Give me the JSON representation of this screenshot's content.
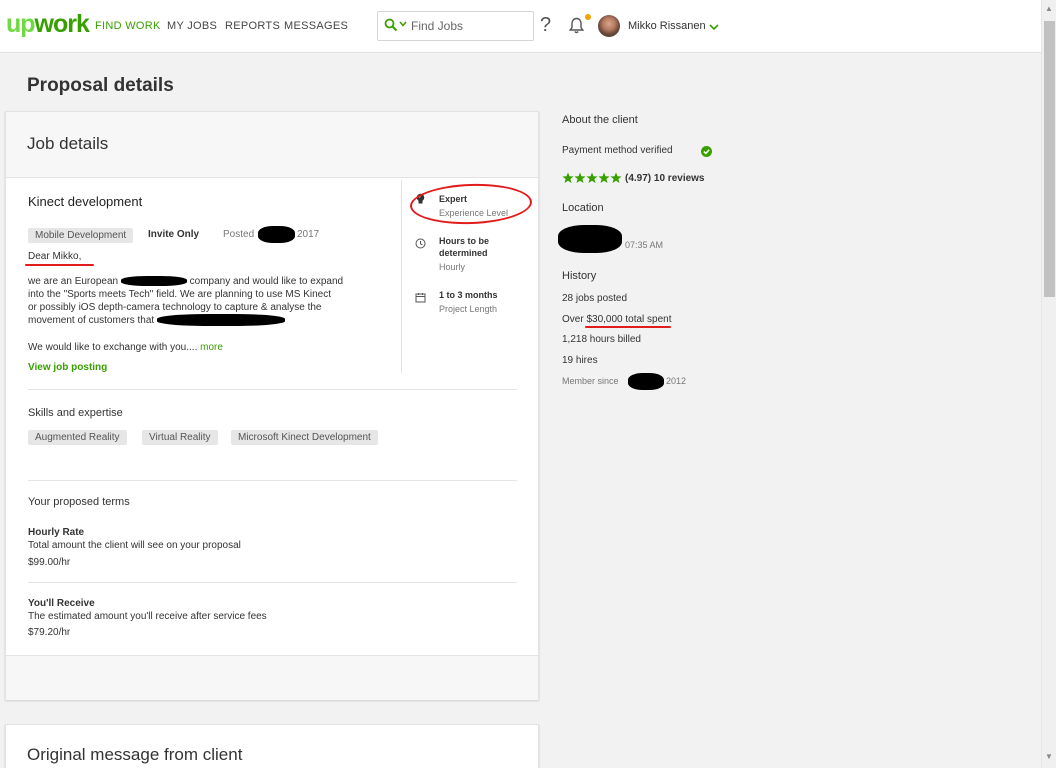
{
  "nav": {
    "logo": "upwork",
    "items": [
      {
        "label": "FIND WORK",
        "active": true
      },
      {
        "label": "MY JOBS",
        "active": false
      },
      {
        "label": "REPORTS",
        "active": false
      },
      {
        "label": "MESSAGES",
        "active": false
      }
    ],
    "search_placeholder": "Find Jobs",
    "help": "?",
    "user_name": "Mikko Rissanen",
    "accent": "#37a000",
    "notification_dot": "#f2a200"
  },
  "page": {
    "title": "Proposal details"
  },
  "job": {
    "header": "Job details",
    "title": "Kinect development",
    "category": "Mobile Development",
    "visibility": "Invite Only",
    "posted_label": "Posted",
    "posted_year": "2017",
    "greeting": "Dear Mikko,",
    "desc_a": "we are an European",
    "desc_b": "company and would like to expand",
    "desc_c": "into the \"Sports meets Tech\" field. We are planning to use MS Kinect",
    "desc_d": "or possibly iOS depth-camera technology to capture & analyse the",
    "desc_e": "movement of customers that",
    "desc_more_text": "We would like to exchange with you....",
    "more": "more",
    "view_posting": "View job posting",
    "features": [
      {
        "icon": "lightbulb-icon",
        "title": "Expert",
        "sub": "Experience Level"
      },
      {
        "icon": "clock-icon",
        "title": "Hours to be determined",
        "sub": "Hourly"
      },
      {
        "icon": "calendar-icon",
        "title": "1 to 3 months",
        "sub": "Project Length"
      }
    ],
    "skills_title": "Skills and expertise",
    "skills": [
      "Augmented Reality",
      "Virtual Reality",
      "Microsoft Kinect Development"
    ],
    "terms_title": "Your proposed terms",
    "hourly_label": "Hourly Rate",
    "hourly_desc": "Total amount the client will see on your proposal",
    "hourly_value": "$99.00/hr",
    "receive_label": "You'll Receive",
    "receive_desc": "The estimated amount you'll receive after service fees",
    "receive_value": "$79.20/hr"
  },
  "original_message": {
    "title": "Original message from client"
  },
  "client": {
    "title": "About the client",
    "payment": "Payment method verified",
    "rating_stars": 5,
    "rating_text": "(4.97) 10 reviews",
    "location_title": "Location",
    "local_time": "07:35 AM",
    "history_title": "History",
    "jobs_posted": "28 jobs posted",
    "spent_prefix": "Over",
    "spent_value": "$30,000 total spent",
    "hours_billed": "1,218 hours billed",
    "hires": "19 hires",
    "member_since_label": "Member since",
    "member_since_year": "2012"
  }
}
